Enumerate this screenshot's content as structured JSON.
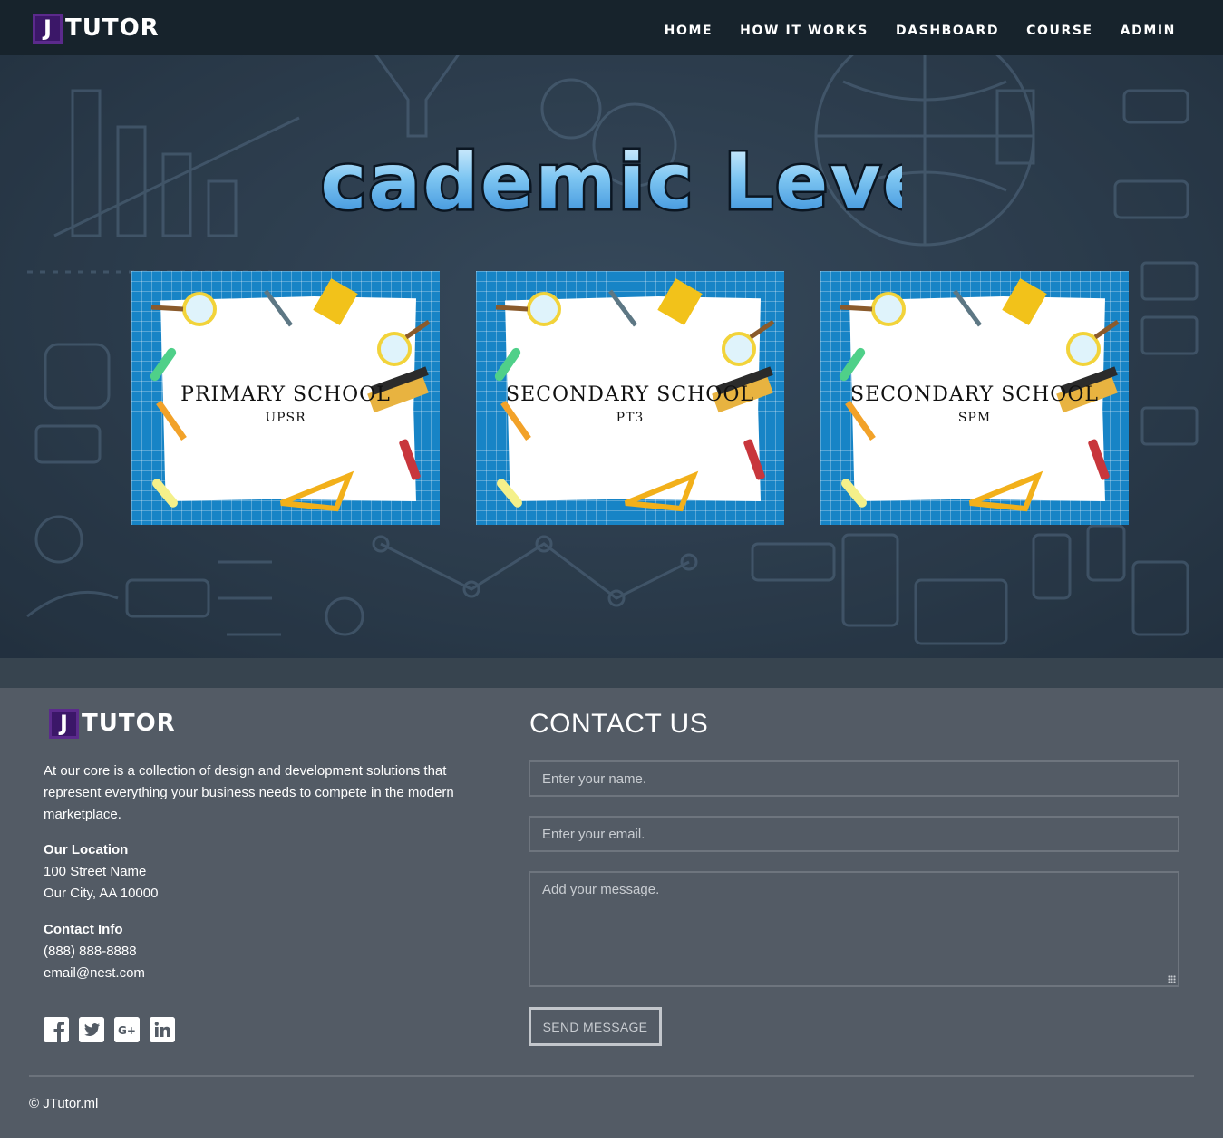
{
  "brand": {
    "letter": "J",
    "name": "TUTOR"
  },
  "nav": {
    "items": [
      {
        "label": "HOME"
      },
      {
        "label": "HOW IT WORKS"
      },
      {
        "label": "DASHBOARD"
      },
      {
        "label": "COURSE"
      },
      {
        "label": "ADMIN"
      }
    ]
  },
  "hero": {
    "title": "Academic Level",
    "cards": [
      {
        "title": "PRIMARY SCHOOL",
        "subtitle": "UPSR"
      },
      {
        "title": "SECONDARY SCHOOL",
        "subtitle": "PT3"
      },
      {
        "title": "SECONDARY SCHOOL",
        "subtitle": "SPM"
      }
    ]
  },
  "footer": {
    "about": "At our core is a collection of design and development solutions that represent everything your business needs to compete in the modern marketplace.",
    "location": {
      "heading": "Our Location",
      "line1": "100 Street Name",
      "line2": "Our City, AA 10000"
    },
    "contact_info": {
      "heading": "Contact Info",
      "phone": "(888) 888-8888",
      "email": "email@nest.com"
    },
    "socials": [
      "facebook-icon",
      "twitter-icon",
      "google-plus-icon",
      "linkedin-icon"
    ],
    "copyright": "© JTutor.ml"
  },
  "contact_form": {
    "title": "CONTACT US",
    "name_placeholder": "Enter your name.",
    "email_placeholder": "Enter your email.",
    "message_placeholder": "Add your message.",
    "submit_label": "SEND MESSAGE"
  },
  "colors": {
    "navbar": "#17232c",
    "hero_background": "#2b3b4c",
    "footer_background": "#535b65",
    "brand_accent": "#3b1768",
    "card_blue": "#1784c6"
  }
}
